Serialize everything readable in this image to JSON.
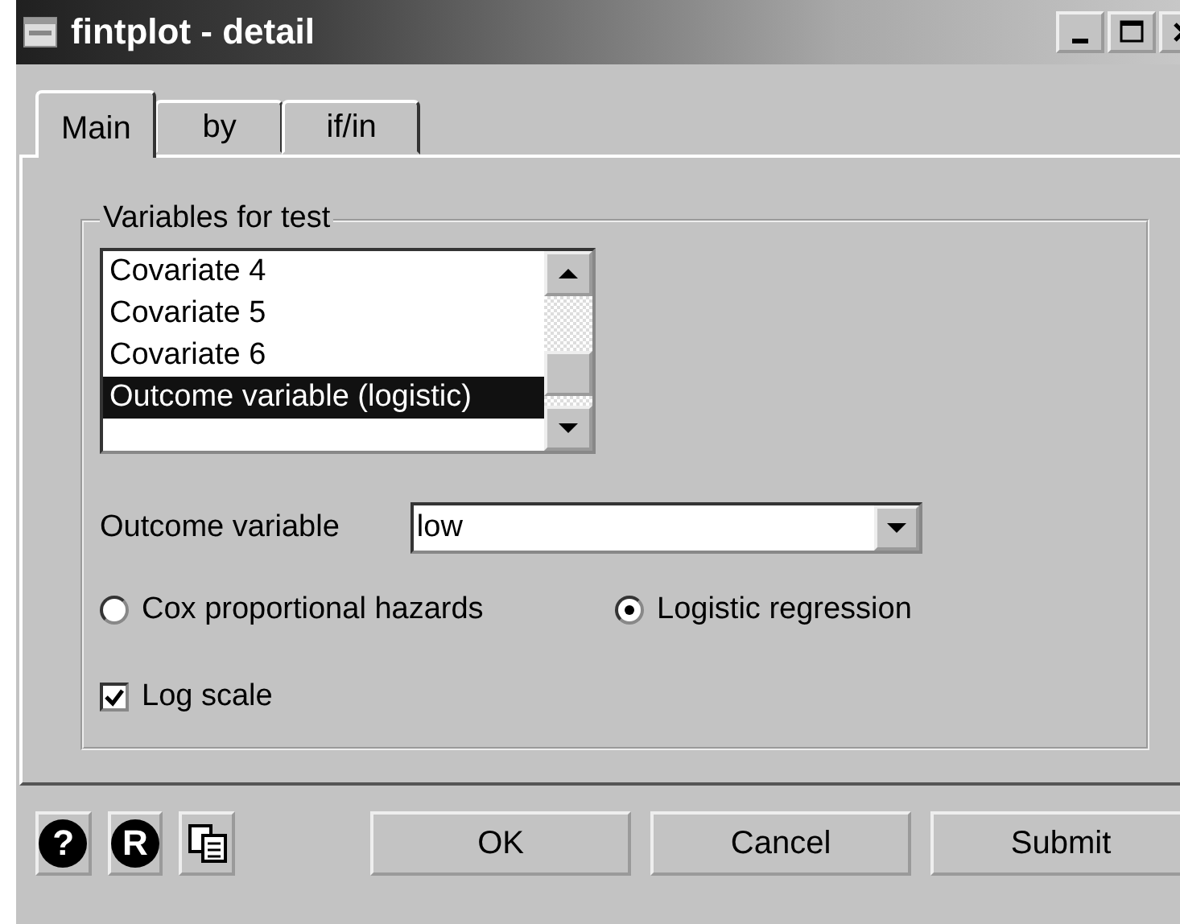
{
  "window": {
    "title": "fintplot - detail"
  },
  "tabs": [
    {
      "label": "Main",
      "selected": true
    },
    {
      "label": "by",
      "selected": false
    },
    {
      "label": "if/in",
      "selected": false
    }
  ],
  "variables_group": {
    "title": "Variables for test",
    "items": [
      {
        "label": "Covariate 4",
        "selected": false
      },
      {
        "label": "Covariate 5",
        "selected": false
      },
      {
        "label": "Covariate 6",
        "selected": false
      },
      {
        "label": "Outcome variable (logistic)",
        "selected": true
      }
    ]
  },
  "outcome_variable": {
    "label": "Outcome variable",
    "value": "low"
  },
  "model_options": [
    {
      "label": "Cox proportional hazards",
      "selected": false
    },
    {
      "label": "Logistic regression",
      "selected": true
    }
  ],
  "log_scale": {
    "label": "Log scale",
    "checked": true
  },
  "tool_icons": [
    {
      "kind": "help",
      "glyph": "?"
    },
    {
      "kind": "round",
      "glyph": "R"
    },
    {
      "kind": "copy"
    }
  ],
  "buttons": [
    "OK",
    "Cancel",
    "Submit"
  ]
}
